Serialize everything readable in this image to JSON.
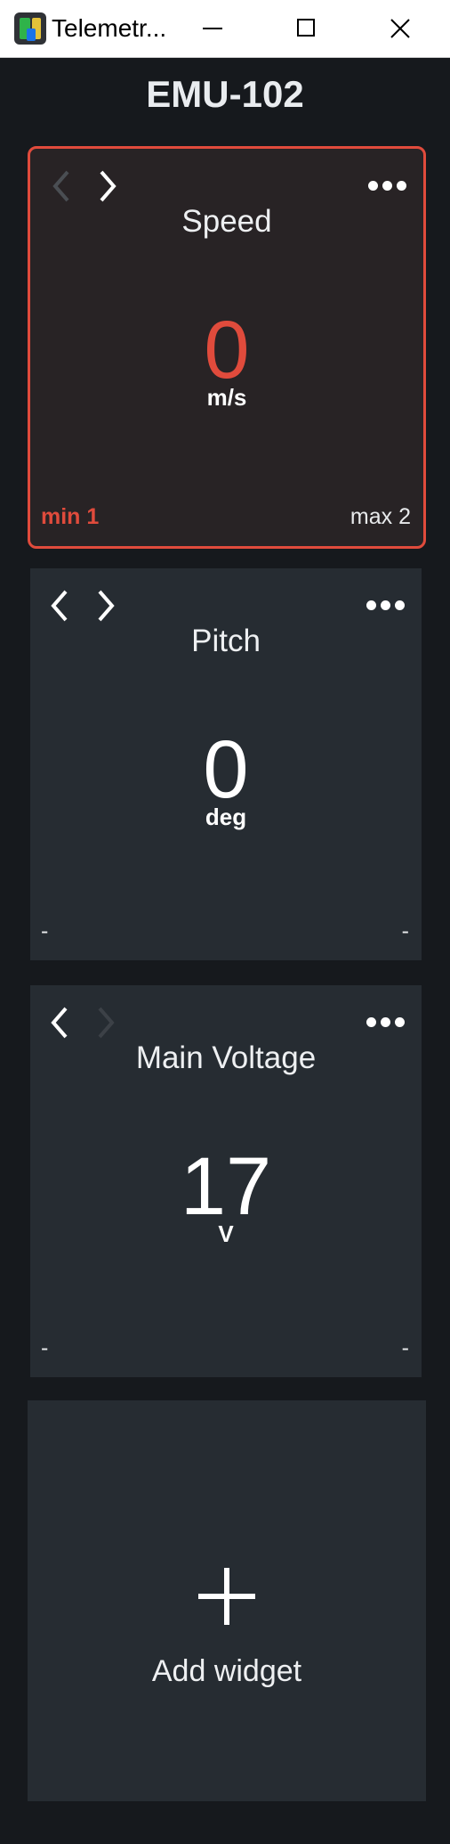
{
  "window": {
    "title": "Telemetr...",
    "minimize_icon": "minimize-icon",
    "maximize_icon": "maximize-icon",
    "close_icon": "close-icon"
  },
  "device": {
    "name": "EMU-102"
  },
  "widgets": [
    {
      "title": "Speed",
      "value": "0",
      "unit": "m/s",
      "min": "min 1",
      "max": "max 2",
      "prev_enabled": false,
      "next_enabled": true,
      "alert": true,
      "alert_color": "#e04b3c"
    },
    {
      "title": "Pitch",
      "value": "0",
      "unit": "deg",
      "min": "-",
      "max": "-",
      "prev_enabled": true,
      "next_enabled": true,
      "alert": false
    },
    {
      "title": "Main Voltage",
      "value": "17",
      "unit": "V",
      "min": "-",
      "max": "-",
      "prev_enabled": true,
      "next_enabled": false,
      "alert": false
    }
  ],
  "add_widget": {
    "label": "Add widget"
  },
  "colors": {
    "background": "#16191d",
    "card": "#262c32",
    "alert": "#e04b3c"
  }
}
